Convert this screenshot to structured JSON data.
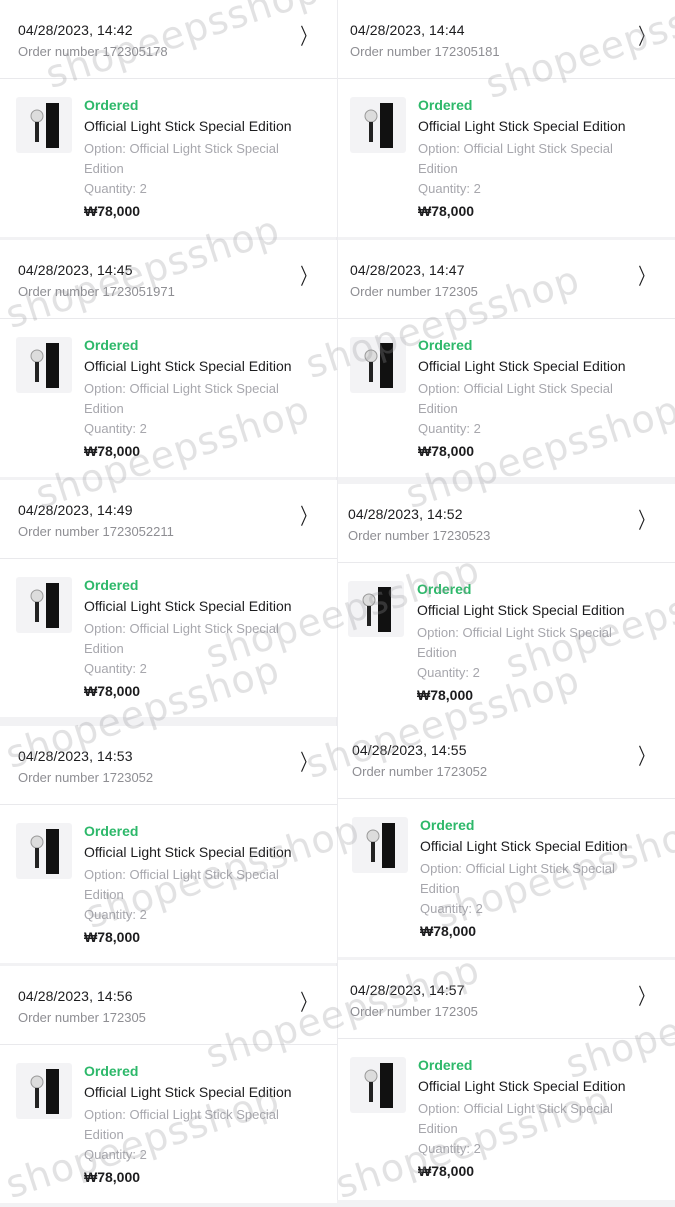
{
  "left": [
    {
      "date": "04/28/2023, 14:42",
      "order_no": "Order number 172305178",
      "status": "Ordered",
      "title": "Official Light Stick Special Edition",
      "option": "Option: Official Light Stick Special Edition",
      "quantity": "Quantity: 2",
      "price": "₩78,000"
    },
    {
      "date": "04/28/2023, 14:45",
      "order_no": "Order number 1723051971",
      "status": "Ordered",
      "title": "Official Light Stick Special Edition",
      "option": "Option: Official Light Stick Special Edition",
      "quantity": "Quantity: 2",
      "price": "₩78,000"
    },
    {
      "date": "04/28/2023, 14:49",
      "order_no": "Order number 1723052211",
      "status": "Ordered",
      "title": "Official Light Stick Special Edition",
      "option": "Option: Official Light Stick Special Edition",
      "quantity": "Quantity: 2",
      "price": "₩78,000"
    },
    {
      "date": "04/28/2023, 14:53",
      "order_no": "Order number 1723052",
      "status": "Ordered",
      "title": "Official Light Stick Special Edition",
      "option": "Option: Official Light Stick Special Edition",
      "quantity": "Quantity: 2",
      "price": "₩78,000"
    },
    {
      "date": "04/28/2023, 14:56",
      "order_no": "Order number 172305",
      "status": "Ordered",
      "title": "Official Light Stick Special Edition",
      "option": "Option: Official Light Stick Special Edition",
      "quantity": "Quantity: 2",
      "price": "₩78,000"
    }
  ],
  "right": [
    {
      "date": "04/28/2023, 14:44",
      "order_no": "Order number 172305181",
      "status": "Ordered",
      "title": "Official Light Stick Special Edition",
      "option": "Option: Official Light Stick Special Edition",
      "quantity": "Quantity: 2",
      "price": "₩78,000"
    },
    {
      "date": "04/28/2023, 14:47",
      "order_no": "Order number 172305",
      "status": "Ordered",
      "title": "Official Light Stick Special Edition",
      "option": "Option: Official Light Stick Special Edition",
      "quantity": "Quantity: 2",
      "price": "₩78,000"
    },
    {
      "date": "04/28/2023, 14:52",
      "order_no": "Order number 17230523",
      "status": "Ordered",
      "title": "Official Light Stick Special Edition",
      "option": "Option: Official Light Stick Special Edition",
      "quantity": "Quantity: 2",
      "price": "₩78,000"
    },
    {
      "date": "04/28/2023, 14:55",
      "order_no": "Order number 1723052",
      "status": "Ordered",
      "title": "Official Light Stick Special Edition",
      "option": "Option: Official Light Stick Special Edition",
      "quantity": "Quantity: 2",
      "price": "₩78,000"
    },
    {
      "date": "04/28/2023, 14:57",
      "order_no": "Order number 172305",
      "status": "Ordered",
      "title": "Official Light Stick Special Edition",
      "option": "Option: Official Light Stick Special Edition",
      "quantity": "Quantity: 2",
      "price": "₩78,000"
    }
  ],
  "chevron_icon": "chevron-right-icon",
  "product_icon": "light-stick-icon",
  "watermark": "shopeepsshop",
  "colors": {
    "status": "#2db86a",
    "text": "#1c1c1e",
    "muted": "#a7a7ad"
  }
}
